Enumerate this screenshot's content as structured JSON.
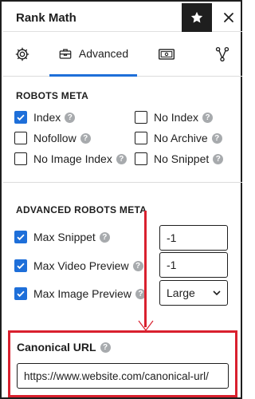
{
  "app": {
    "title": "Rank Math"
  },
  "tabs": [
    {
      "id": "general",
      "icon": "gear-icon"
    },
    {
      "id": "advanced",
      "label": "Advanced",
      "icon": "toolbox-icon",
      "active": true
    },
    {
      "id": "schema",
      "icon": "schema-icon"
    },
    {
      "id": "social",
      "icon": "social-graph-icon"
    }
  ],
  "robots_meta": {
    "title": "ROBOTS META",
    "options": [
      {
        "label": "Index",
        "checked": true
      },
      {
        "label": "No Index",
        "checked": false
      },
      {
        "label": "Nofollow",
        "checked": false
      },
      {
        "label": "No Archive",
        "checked": false
      },
      {
        "label": "No Image Index",
        "checked": false
      },
      {
        "label": "No Snippet",
        "checked": false
      }
    ]
  },
  "advanced_robots_meta": {
    "title": "ADVANCED ROBOTS META",
    "options": [
      {
        "label": "Max Snippet",
        "checked": true,
        "value": "-1"
      },
      {
        "label": "Max Video Preview",
        "checked": true,
        "value": "-1"
      },
      {
        "label": "Max Image Preview",
        "checked": true,
        "value": "Large"
      }
    ]
  },
  "canonical": {
    "label": "Canonical URL",
    "value": "https://www.website.com/canonical-url/"
  },
  "colors": {
    "accent": "#1e6fd9",
    "highlight": "#d9202e",
    "help_icon": "#a7aaad"
  }
}
